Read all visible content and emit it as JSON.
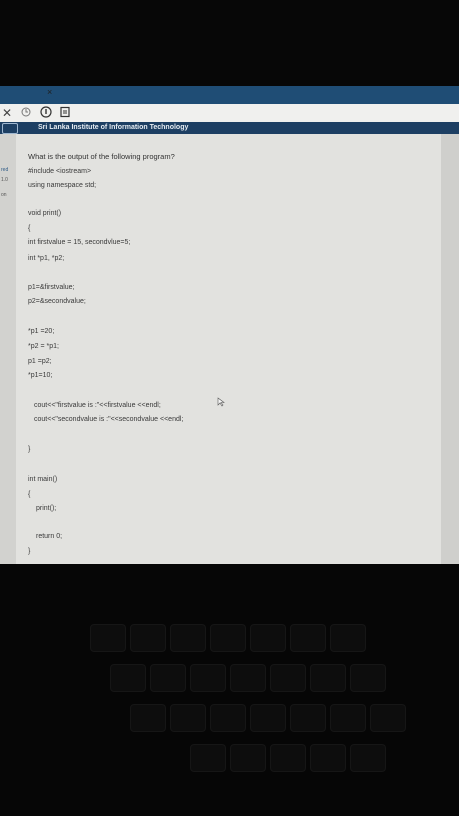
{
  "browser": {
    "tab_close_symbol": "×",
    "toolbar_close_symbol": "✕",
    "toolbar_icons": [
      "close-icon",
      "history-icon",
      "info-icon",
      "bookmark-icon"
    ]
  },
  "banner": {
    "title": "Sri Lanka Institute of Information Technology"
  },
  "side_panel": {
    "labels": [
      "red",
      "1.0",
      "on"
    ]
  },
  "question": {
    "prompt": "What is the output of the following program?",
    "code_lines": [
      "#include <iostream>",
      "using namespace std;",
      "void print()",
      "{",
      "int firstvalue = 15, secondvlue=5;",
      "int *p1, *p2;",
      "p1=&firstvalue;",
      "p2=&secondvalue;",
      "*p1 =20;",
      "*p2 = *p1;",
      "p1 =p2;",
      "*p1=10;",
      "cout<<\"firstvalue is :\"<<firstvalue <<endl;",
      "cout<<\"secondvalue is :\"<<secondvalue <<endl;",
      "}",
      "int main()",
      "{",
      "print();",
      "return 0;",
      "}"
    ]
  }
}
